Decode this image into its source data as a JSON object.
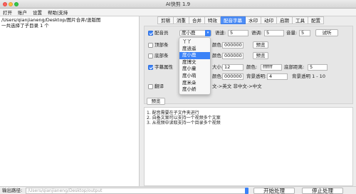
{
  "window": {
    "title": "AI快剪  1.9"
  },
  "menu": [
    "打开",
    "账户",
    "设置",
    "帮助|支持"
  ],
  "left_panel": {
    "lines": [
      "/Users/qianjianeng/Desktop/图片合并/竖版图",
      "一共选择了子目录 1 个"
    ]
  },
  "tabs": {
    "items": [
      "剪辑",
      "消重",
      "合并",
      "特效",
      "配音字幕",
      "水印",
      "动印",
      "启期",
      "工具",
      "配置"
    ],
    "active_index": 4
  },
  "dubbing": {
    "checkbox_label": "配音员",
    "checked": true,
    "voice_selected": "度小鹿",
    "speed_label": "语速:",
    "speed_value": "5",
    "tone_label": "语调:",
    "tone_value": "5",
    "volume_label": "音量:",
    "volume_value": "5",
    "listen_button": "试听"
  },
  "voice_options": [
    "丫丫",
    "度逍遥",
    "度小鹿",
    "度博文",
    "度小童",
    "度小萌",
    "度米朵",
    "度小娇"
  ],
  "voice_selected_index": 2,
  "top_bar": {
    "label": "顶部条",
    "checked": false,
    "color_label": "颜色:",
    "color_value": "000000",
    "preview_button": "预览"
  },
  "bottom_bar_row": {
    "label": "底部条",
    "checked": false,
    "color_label": "颜色:",
    "color_value": "000000",
    "preview_button": "预览"
  },
  "subtitle": {
    "label": "字幕属性",
    "checked": true,
    "size_label": "大小:",
    "size_value": "12",
    "color_label": "颜色:",
    "color_value": "ffffff",
    "margin_label": "底部距离:",
    "margin_value": "5",
    "bg_label_prefix": "颜色:",
    "bg_color_value": "000000",
    "bg_opacity_label": "背景透明:",
    "bg_opacity_value": "4",
    "bg_opacity_hint": "背景透明 1 - 10"
  },
  "translate": {
    "label": "翻译",
    "checked": false,
    "hint": "文->英文  非中文->中文"
  },
  "preview_button": "预览",
  "notes": [
    "1. 配音需要在子文件夹进行",
    "2. 自备文案可以支持一个视频多个文案",
    "3. 从视频中读取支持一个目录多个视频"
  ],
  "footer": {
    "output_label": "输出路径:",
    "output_path": "/Users/qianjianeng/Desktop/output",
    "start_button": "开始处理",
    "stop_button": "停止处理"
  }
}
